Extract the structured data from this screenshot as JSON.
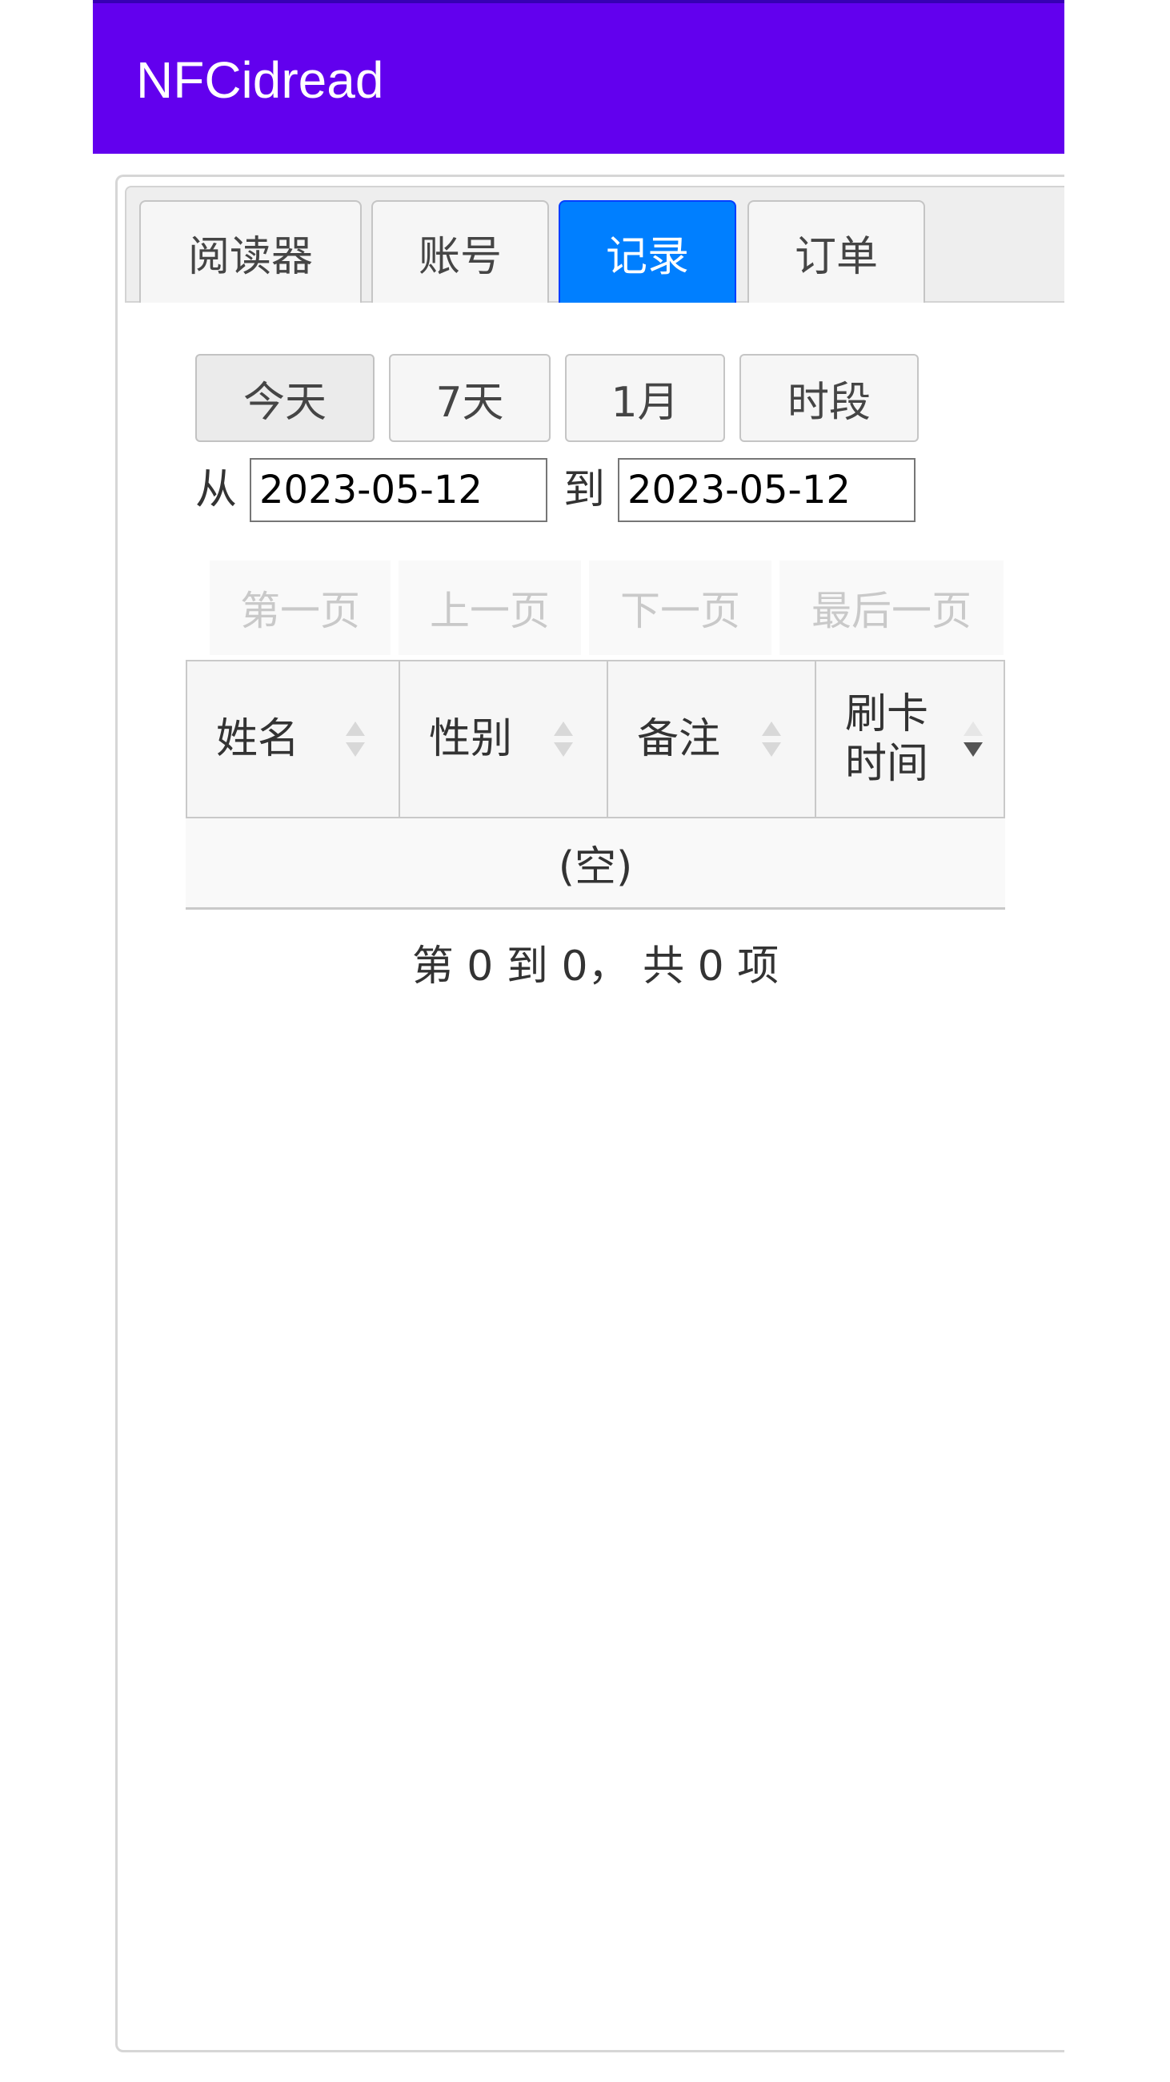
{
  "app": {
    "title": "NFCidread"
  },
  "tabs": [
    {
      "label": "阅读器",
      "active": false
    },
    {
      "label": "账号",
      "active": false
    },
    {
      "label": "记录",
      "active": true
    },
    {
      "label": "订单",
      "active": false
    }
  ],
  "range_buttons": [
    {
      "label": "今天",
      "selected": true
    },
    {
      "label": "7天",
      "selected": false
    },
    {
      "label": "1月",
      "selected": false
    },
    {
      "label": "时段",
      "selected": false
    }
  ],
  "date_filter": {
    "from_label": "从",
    "from_value": "2023-05-12",
    "to_label": "到",
    "to_value": "2023-05-12"
  },
  "pager": {
    "first": "第一页",
    "prev": "上一页",
    "next": "下一页",
    "last": "最后一页"
  },
  "table": {
    "columns": [
      {
        "label": "姓名",
        "sort": "none"
      },
      {
        "label": "性别",
        "sort": "none"
      },
      {
        "label": "备注",
        "sort": "none"
      },
      {
        "label": "刷卡\n时间",
        "sort": "descending"
      }
    ],
    "empty_text": "(空)",
    "info": "第 0 到 0， 共 0 项"
  },
  "colors": {
    "appbar": "#6200ee",
    "active_tab": "#007fff"
  }
}
